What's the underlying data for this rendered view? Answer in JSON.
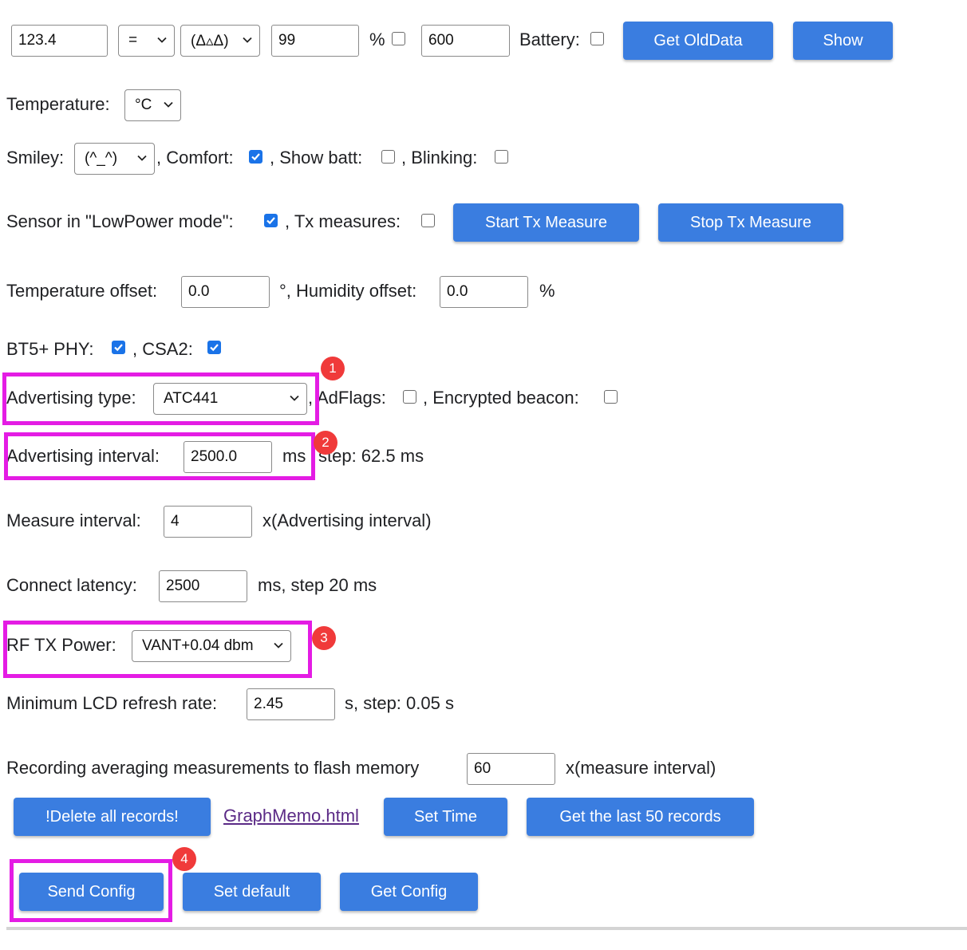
{
  "top_row": {
    "value_input": "123.4",
    "operator_select": "=",
    "face_select": "(Δ▵Δ)",
    "percent_input": "99",
    "percent_label": "%",
    "count_input": "600",
    "battery_label": "Battery:",
    "get_olddata_label": "Get OldData",
    "show_label": "Show"
  },
  "temperature": {
    "label": "Temperature:",
    "unit_select": "°C"
  },
  "smiley_row": {
    "smiley_label": "Smiley:",
    "smiley_select": "(^_^)",
    "comfort_label": ", Comfort:",
    "show_batt_label": ", Show batt:",
    "blinking_label": ", Blinking:"
  },
  "lowpower_row": {
    "lowpower_label": "Sensor in \"LowPower mode\":",
    "tx_measures_label": ", Tx measures:",
    "start_tx_label": "Start Tx Measure",
    "stop_tx_label": "Stop Tx Measure"
  },
  "offset_row": {
    "temp_offset_label": "Temperature offset:",
    "temp_offset_value": "0.0",
    "humidity_offset_label": "°, Humidity offset:",
    "humidity_offset_value": "0.0",
    "percent_label": "%"
  },
  "phy_row": {
    "bt5_label": "BT5+ PHY:",
    "csa2_label": ", CSA2:"
  },
  "adv_type_row": {
    "label": "Advertising type:",
    "select_value": "ATC441",
    "adflags_label": ", AdFlags:",
    "encrypted_label": ", Encrypted beacon:"
  },
  "adv_interval_row": {
    "label": "Advertising interval:",
    "value": "2500.0",
    "unit": "ms",
    "step_text": "step: 62.5 ms"
  },
  "measure_interval_row": {
    "label": "Measure interval:",
    "value": "4",
    "suffix": "x(Advertising interval)"
  },
  "latency_row": {
    "label": "Connect latency:",
    "value": "2500",
    "suffix": "ms, step 20 ms"
  },
  "rf_power_row": {
    "label": "RF TX Power:",
    "select_value": "VANT+0.04 dbm"
  },
  "lcd_row": {
    "label": "Minimum LCD refresh rate:",
    "value": "2.45",
    "suffix": "s, step: 0.05 s"
  },
  "recording_row": {
    "label": "Recording averaging measurements to flash memory",
    "value": "60",
    "suffix": "x(measure interval)"
  },
  "records_row": {
    "delete_label": "!Delete all records!",
    "graph_link": "GraphMemo.html",
    "set_time_label": "Set Time",
    "last50_label": "Get the last 50 records"
  },
  "config_row": {
    "send_label": "Send Config",
    "default_label": "Set default",
    "get_label": "Get Config"
  },
  "annotations": [
    "1",
    "2",
    "3",
    "4"
  ],
  "colors": {
    "button_blue": "#3a7de0",
    "checkbox_blue": "#1a73e8",
    "highlight_magenta": "#e41ce4",
    "badge_red": "#f03a3a",
    "link_purple": "#5b2a86"
  },
  "checkboxes": {
    "percent": false,
    "battery": false,
    "comfort": true,
    "show_batt": false,
    "blinking": false,
    "lowpower": true,
    "tx_measures": false,
    "bt5_phy": true,
    "csa2": true,
    "adflags": false,
    "encrypted": false
  }
}
